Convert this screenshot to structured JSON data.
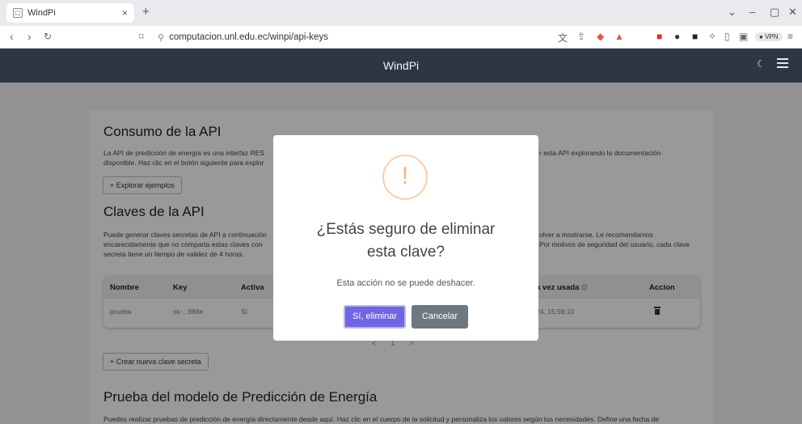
{
  "browser": {
    "tab_title": "WindPi",
    "tab_close": "×",
    "new_tab": "+",
    "url": "computacion.unl.edu.ec/winpi/api-keys",
    "vpn_label": "VPN"
  },
  "app": {
    "title": "WindPi"
  },
  "api_usage": {
    "heading": "Consumo de la API",
    "description_line1": "La API de predicción de energía es una interfaz RES",
    "description_line1_end": "r esta API explorando la documentación",
    "description_line2": "disponible. Haz clic en el botón siguiente para explor",
    "explore_button": "+ Explorar ejemplos"
  },
  "api_keys": {
    "heading": "Claves de la API",
    "description_line1": "Puede generar claves secretas de API a continuación",
    "description_line1_end": "olver a mostrarse. Le recomendamos",
    "description_line2": "encarecidamente que no comparta estas claves con",
    "description_line2_end": "Por motivos de seguridad del usuario, cada clave",
    "description_line3": "secreta tiene un tiempo de validez de 4 horas.",
    "table": {
      "columns": [
        "Nombre",
        "Key",
        "Activa",
        "a vez usada",
        "Accion"
      ],
      "rows": [
        {
          "name": "prueba",
          "key": "sk-...988e",
          "active": "Sí",
          "last_used": "24, 15:59:10"
        }
      ]
    },
    "pager": {
      "prev": "<",
      "page": "1",
      "next": ">"
    },
    "create_button": "+ Crear nueva clave secreta"
  },
  "test_section": {
    "heading": "Prueba del modelo de Predicción de Energía",
    "description": "Puedes realizar pruebas de predicción de energía directamente desde aquí. Haz clic en el cuerpo de la solicitud y personaliza los valores según tus necesidades. Define una fecha de"
  },
  "modal": {
    "icon": "!",
    "title_line1": "¿Estás seguro de eliminar",
    "title_line2": "esta clave?",
    "text": "Esta acción no se puede deshacer.",
    "confirm_button": "Sí, eliminar",
    "cancel_button": "Cancelar"
  },
  "colors": {
    "appbar": "#2d3744",
    "confirm": "#7066e0",
    "cancel": "#6e7881",
    "warning": "#f8bb86"
  }
}
